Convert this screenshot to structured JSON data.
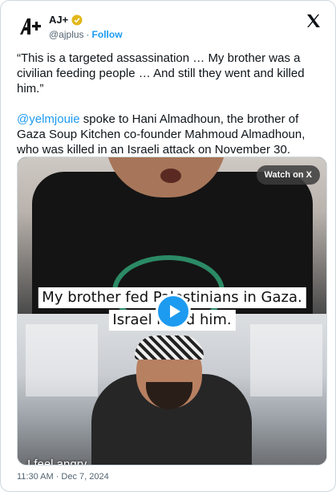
{
  "author": {
    "name": "AJ+",
    "handle": "@ajplus",
    "separator": "·",
    "follow_label": "Follow",
    "verified_color": "#e2b719"
  },
  "post": {
    "quote": "“This is a targeted assassination … My brother was a civilian feeding people … And still they went and killed him.”",
    "mention": "@yelmjouie",
    "body_rest": " spoke to Hani Almadhoun, the brother of Gaza Soup Kitchen co-founder Mahmoud Almadhoun, who was killed in an Israeli attack on November 30.",
    "timestamp": "11:30 AM · Dec 7, 2024"
  },
  "video": {
    "watch_on_label": "Watch on X",
    "caption_line1": "My brother fed Palestinians in Gaza.",
    "caption_line2": "Israel killed him.",
    "bottom_subtitle": "I feel angry"
  },
  "colors": {
    "accent": "#1d9bf0",
    "text": "#0f1419",
    "muted": "#536471"
  },
  "icons": [
    "ajplus-logo-icon",
    "verified-badge-icon",
    "x-logo-icon",
    "play-icon"
  ]
}
